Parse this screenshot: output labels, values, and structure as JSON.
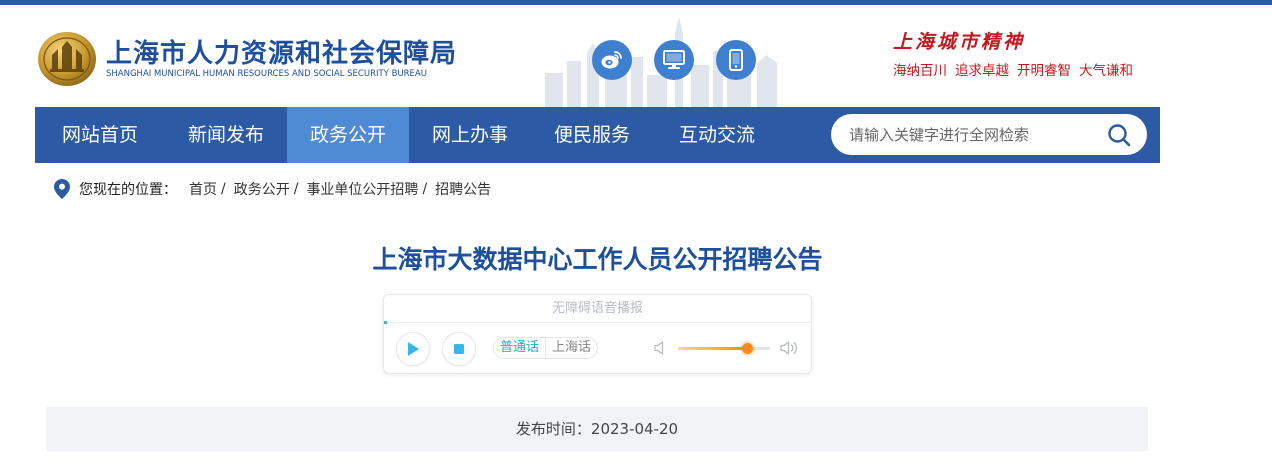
{
  "header": {
    "logo_cn": "上海市人力资源和社会保障局",
    "logo_en": "SHANGHAI MUNICIPAL HUMAN RESOURCES AND SOCIAL SECURITY BUREAU",
    "icons": [
      "weibo-icon",
      "desktop-icon",
      "mobile-icon"
    ],
    "spirit_title": "上海城市精神",
    "spirit_motto": [
      "海纳百川",
      "追求卓越",
      "开明睿智",
      "大气谦和"
    ]
  },
  "nav": {
    "items": [
      "网站首页",
      "新闻发布",
      "政务公开",
      "网上办事",
      "便民服务",
      "互动交流"
    ],
    "active_index": 2,
    "search_placeholder": "请输入关键字进行全网检索"
  },
  "breadcrumb": {
    "label": "您现在的位置：",
    "items": [
      "首页",
      "政务公开",
      "事业单位公开招聘",
      "招聘公告"
    ],
    "separator": "/"
  },
  "article": {
    "title": "上海市大数据中心工作人员公开招聘公告",
    "publish_time": "发布时间：2023-04-20"
  },
  "player": {
    "heading": "无障碍语音播报",
    "languages": [
      "普通话",
      "上海话"
    ],
    "active_language": "普通话",
    "volume_fraction": 0.75
  },
  "colors": {
    "brand_blue": "#2c5aa5",
    "nav_active": "#4f8ad5",
    "title_blue": "#1d4f9c",
    "spirit_red": "#c8161d",
    "accent_cyan": "#27a6d4",
    "volume_orange": "#ff8a1c"
  }
}
